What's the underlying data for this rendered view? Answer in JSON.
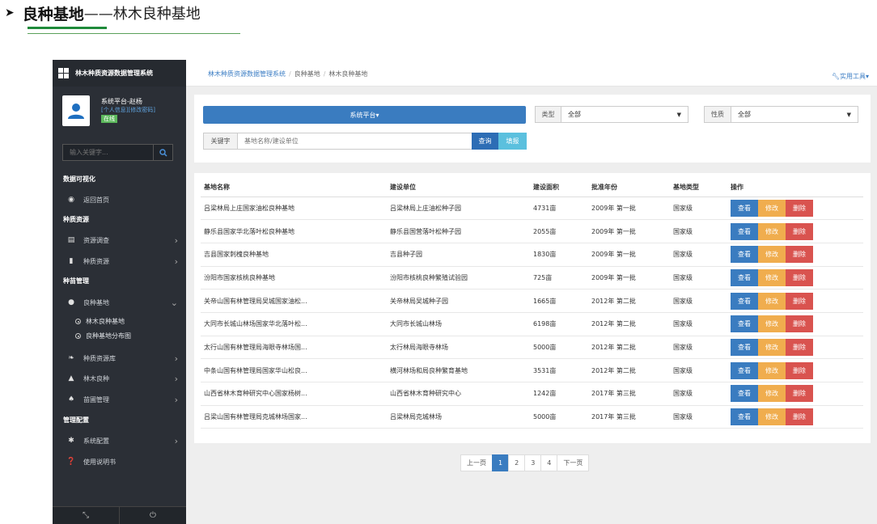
{
  "heading": {
    "title": "良种基地",
    "subtitle": "——林木良种基地"
  },
  "sidebar": {
    "app_title": "林木种质资源数据管理系统",
    "user": {
      "name": "系统平台-赵杨",
      "link_info": "[个人信息]",
      "link_pwd": "[修改密码]",
      "status": "在线"
    },
    "search_placeholder": "输入关键字...",
    "sections": [
      "数据可视化",
      "种质资源",
      "种苗管理",
      "管理配置"
    ],
    "items": [
      {
        "label": "返回首页",
        "icon": "globe-icon"
      },
      {
        "label": "资源调查",
        "icon": "list-icon"
      },
      {
        "label": "种质资源",
        "icon": "book-icon"
      },
      {
        "label": "良种基地",
        "icon": "pin-icon"
      },
      {
        "label": "种质资源库",
        "icon": "leaf-icon"
      },
      {
        "label": "林木良种",
        "icon": "tree-icon"
      },
      {
        "label": "苗圃管理",
        "icon": "seedling-icon"
      },
      {
        "label": "系统配置",
        "icon": "gear-icon"
      },
      {
        "label": "使用说明书",
        "icon": "help-icon"
      }
    ],
    "subitems": [
      "林木良种基地",
      "良种基地分布图"
    ]
  },
  "breadcrumb": [
    "林木种质资源数据管理系统",
    "良种基地",
    "林木良种基地"
  ],
  "tools_label": "实用工具",
  "filters": {
    "platform_label": "系统平台",
    "type_label": "类型",
    "type_value": "全部",
    "nature_label": "性质",
    "nature_value": "全部",
    "keyword_label": "关键字",
    "keyword_placeholder": "基地名称/建设单位",
    "query_label": "查询",
    "fill_label": "填报"
  },
  "table": {
    "headers": [
      "基地名称",
      "建设单位",
      "建设面积",
      "批准年份",
      "基地类型",
      "操作"
    ],
    "actions": {
      "view": "查看",
      "edit": "修改",
      "delete": "删除"
    },
    "rows": [
      [
        "吕梁林局上庄国家油松良种基地",
        "吕梁林局上庄油松种子园",
        "4731亩",
        "2009年 第一批",
        "国家级"
      ],
      [
        "静乐县国家华北落叶松良种基地",
        "静乐县国营落叶松种子园",
        "2055亩",
        "2009年 第一批",
        "国家级"
      ],
      [
        "吉县国家刺槐良种基地",
        "吉县种子园",
        "1830亩",
        "2009年 第一批",
        "国家级"
      ],
      [
        "汾阳市国家核桃良种基地",
        "汾阳市核桃良种繁殖试验园",
        "725亩",
        "2009年 第一批",
        "国家级"
      ],
      [
        "关帝山国有林管理局吴城国家油松...",
        "关帝林局吴城种子园",
        "1665亩",
        "2012年 第二批",
        "国家级"
      ],
      [
        "大同市长城山林场国家华北落叶松...",
        "大同市长城山林场",
        "6198亩",
        "2012年 第二批",
        "国家级"
      ],
      [
        "太行山国有林管理局海眼寺林场国...",
        "太行林局海眼寺林场",
        "5000亩",
        "2012年 第二批",
        "国家级"
      ],
      [
        "中条山国有林管理局国家华山松良...",
        "横河林场和局良种繁育基地",
        "3531亩",
        "2012年 第二批",
        "国家级"
      ],
      [
        "山西省林木育种研究中心国家杨树...",
        "山西省林木育种研究中心",
        "1242亩",
        "2017年 第三批",
        "国家级"
      ],
      [
        "吕梁山国有林管理局克城林场国家...",
        "吕梁林局克城林场",
        "5000亩",
        "2017年 第三批",
        "国家级"
      ]
    ]
  },
  "pagination": {
    "prev": "上一页",
    "pages": [
      "1",
      "2",
      "3",
      "4"
    ],
    "next": "下一页",
    "current": "1"
  }
}
